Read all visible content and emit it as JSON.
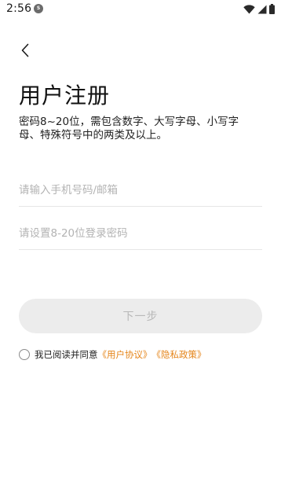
{
  "status_bar": {
    "time": "2:56",
    "app_icon_text": "S"
  },
  "header": {
    "back_icon": "chevron-left-icon"
  },
  "page": {
    "title": "用户注册",
    "password_hint": "密码8~20位，需包含数字、大写字母、小写字母、特殊符号中的两类及以上。"
  },
  "form": {
    "phone_placeholder": "请输入手机号码/邮箱",
    "phone_value": "",
    "password_placeholder": "请设置8-20位登录密码",
    "password_value": "",
    "next_label": "下一步"
  },
  "agreement": {
    "checked": false,
    "text": "我已阅读并同意",
    "user_agreement_link": "《用户协议》",
    "privacy_policy_link": "《隐私政策》"
  },
  "colors": {
    "link": "#e5851a",
    "disabled_button_bg": "#ececec",
    "disabled_button_text": "#b8b8b8"
  }
}
